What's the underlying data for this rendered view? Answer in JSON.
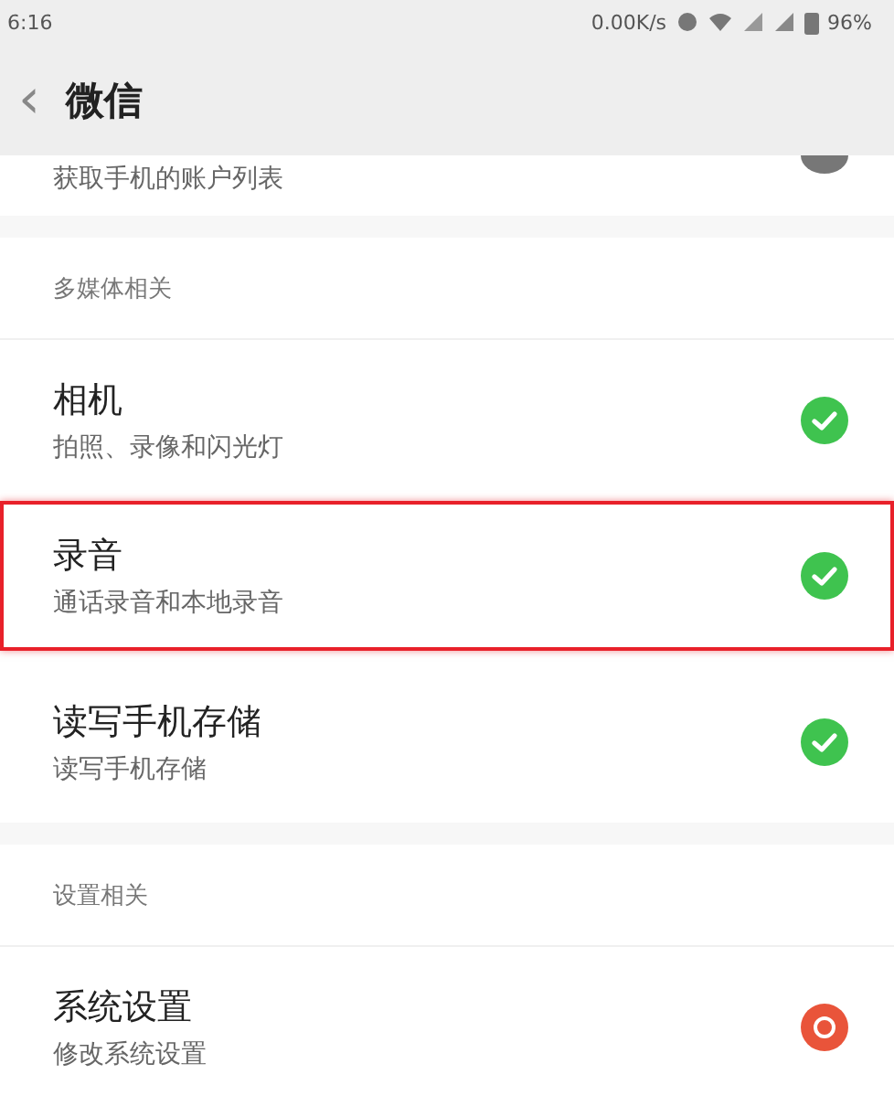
{
  "status_bar": {
    "time": "6:16",
    "speed": "0.00K/s",
    "battery": "96%"
  },
  "header": {
    "back": "‹",
    "title": "微信"
  },
  "groups": [
    {
      "items": [
        {
          "kind": "permission",
          "cut": true,
          "subtitle": "获取手机的账户列表",
          "highlighted": false
        }
      ]
    },
    {
      "items": [
        {
          "kind": "section",
          "title": "多媒体相关"
        },
        {
          "kind": "permission",
          "title": "相机",
          "subtitle": "拍照、录像和闪光灯",
          "granted": true,
          "highlighted": false
        },
        {
          "kind": "permission",
          "title": "录音",
          "subtitle": "通话录音和本地录音",
          "granted": true,
          "highlighted": true
        },
        {
          "kind": "permission",
          "title": "读写手机存储",
          "subtitle": "读写手机存储",
          "granted": true,
          "highlighted": false
        }
      ]
    },
    {
      "items": [
        {
          "kind": "section",
          "title": "设置相关"
        },
        {
          "kind": "permission",
          "title": "系统设置",
          "subtitle": "修改系统设置",
          "granted": false,
          "highlighted": false
        }
      ]
    }
  ]
}
